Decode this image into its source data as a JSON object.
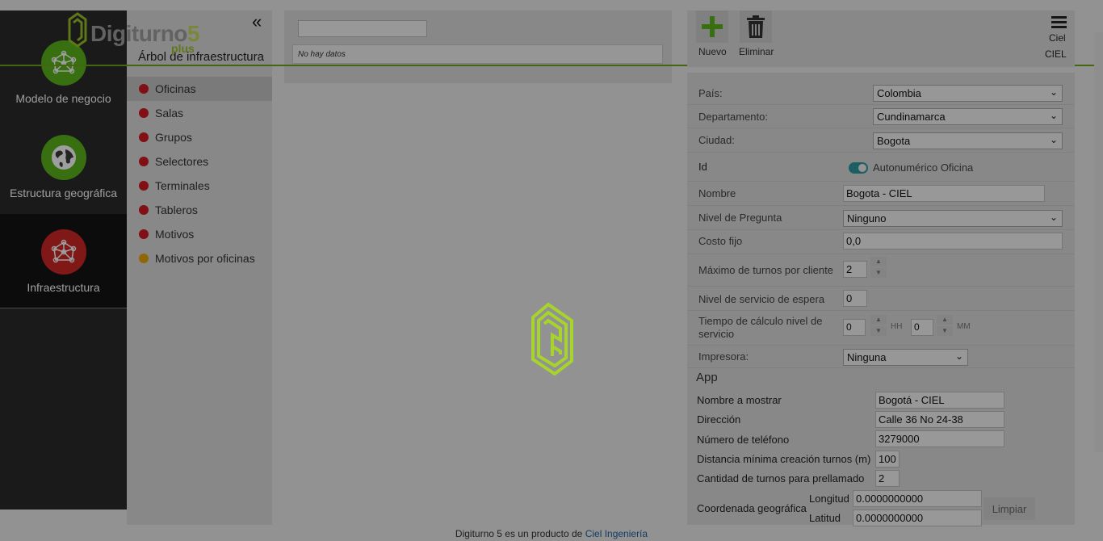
{
  "logo": {
    "text": "Digiturno",
    "five": "5",
    "plus": "plus"
  },
  "left_menu": {
    "items": [
      {
        "label": "Modelo de negocio",
        "icon": "network-icon",
        "color": "#5bb41c"
      },
      {
        "label": "Estructura geográfica",
        "icon": "globe-icon",
        "color": "#5bb41c"
      },
      {
        "label": "Infraestructura",
        "icon": "network-icon",
        "color": "#d12727"
      }
    ]
  },
  "tree": {
    "title": "Árbol de infraestructura",
    "collapse_label": "«",
    "items": [
      {
        "label": "Oficinas",
        "color": "#d1191f"
      },
      {
        "label": "Salas",
        "color": "#d1191f"
      },
      {
        "label": "Grupos",
        "color": "#d1191f"
      },
      {
        "label": "Selectores",
        "color": "#d1191f"
      },
      {
        "label": "Terminales",
        "color": "#d1191f"
      },
      {
        "label": "Tableros",
        "color": "#d1191f"
      },
      {
        "label": "Motivos",
        "color": "#d1191f"
      },
      {
        "label": "Motivos por oficinas",
        "color": "#e8a60a"
      }
    ]
  },
  "middle": {
    "search_value": "",
    "empty_text": "No hay datos"
  },
  "toolbar": {
    "new_label": "Nuevo",
    "delete_label": "Eliminar",
    "user_line1": "Ciel",
    "user_line2": "CIEL"
  },
  "form": {
    "pais": {
      "label": "País:",
      "value": "Colombia"
    },
    "departamento": {
      "label": "Departamento:",
      "value": "Cundinamarca"
    },
    "ciudad": {
      "label": "Ciudad:",
      "value": "Bogota"
    },
    "id": {
      "label": "Id",
      "toggle_label": "Autonumérico Oficina",
      "toggle_on": true
    },
    "nombre": {
      "label": "Nombre",
      "value": "Bogota - CIEL"
    },
    "nivel_pregunta": {
      "label": "Nivel de Pregunta",
      "value": "Ninguno"
    },
    "costo_fijo": {
      "label": "Costo fijo",
      "value": "0,0"
    },
    "max_turnos": {
      "label": "Máximo de turnos por cliente",
      "value": "2"
    },
    "nivel_servicio": {
      "label": "Nivel de servicio de espera",
      "value": "0"
    },
    "tiempo_calculo": {
      "label": "Tiempo de cálculo nivel de servicio",
      "hh_value": "0",
      "hh_unit": "HH",
      "mm_value": "0",
      "mm_unit": "MM"
    },
    "impresora": {
      "label": "Impresora:",
      "value": "Ninguna"
    }
  },
  "app": {
    "title": "App",
    "nombre_mostrar": {
      "label": "Nombre a mostrar",
      "value": "Bogotá - CIEL"
    },
    "direccion": {
      "label": "Dirección",
      "value": "Calle 36 No 24-38"
    },
    "telefono": {
      "label": "Número de teléfono",
      "value": "3279000"
    },
    "distancia": {
      "label": "Distancia mínima creación turnos (m)",
      "value": "100"
    },
    "prellamado": {
      "label": "Cantidad de turnos para prellamado",
      "value": "2"
    },
    "coordenada": {
      "label": "Coordenada geográfica",
      "longitud_label": "Longitud",
      "longitud_value": "0.0000000000",
      "latitud_label": "Latitud",
      "latitud_value": "0.0000000000",
      "clear_label": "Limpiar"
    }
  },
  "footer": {
    "text": "Digiturno 5 es un producto de ",
    "link": "Ciel Ingeniería"
  }
}
